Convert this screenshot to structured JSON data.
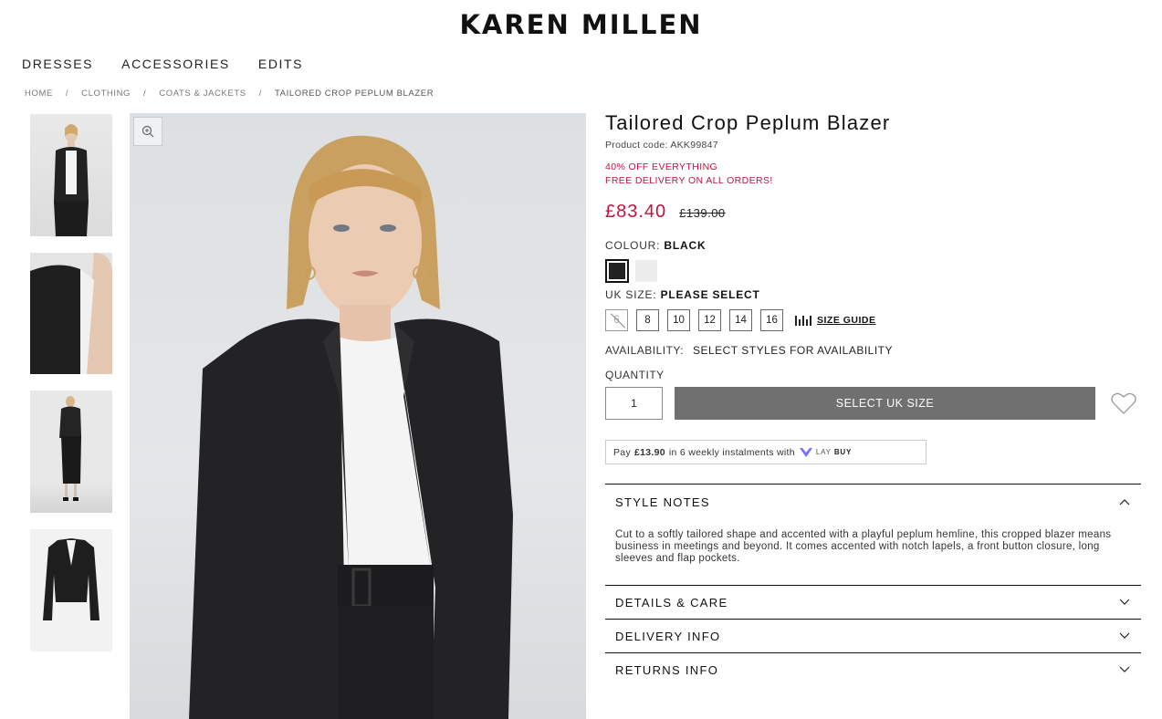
{
  "brand": {
    "logo": "KAREN MILLEN"
  },
  "nav": {
    "items": [
      "DRESSES",
      "ACCESSORIES",
      "EDITS"
    ]
  },
  "breadcrumb": [
    "HOME",
    "CLOTHING",
    "COATS & JACKETS",
    "TAILORED CROP PEPLUM BLAZER"
  ],
  "gallery": {
    "thumbnails": [
      "thumb-front-model",
      "thumb-side-detail",
      "thumb-full-length",
      "thumb-product-flat"
    ]
  },
  "product": {
    "title": "Tailored Crop Peplum Blazer",
    "code": "Product code: AKK99847",
    "promo1": "40% OFF EVERYTHING",
    "promo2": "FREE DELIVERY ON ALL ORDERS!",
    "price_now": "£83.40",
    "price_was": "£139.00",
    "colour_label": "COLOUR:",
    "colour_value": "BLACK",
    "colours": [
      "black",
      "white"
    ],
    "size_label": "UK SIZE:",
    "size_value": "PLEASE SELECT",
    "sizes": [
      "6",
      "8",
      "10",
      "12",
      "14",
      "16"
    ],
    "size_guide": "SIZE GUIDE",
    "availability_label": "AVAILABILITY:",
    "availability_value": "SELECT STYLES FOR AVAILABILITY",
    "quantity_label": "QUANTITY",
    "quantity_value": "1",
    "select_button": "SELECT UK SIZE"
  },
  "laybuy": {
    "prefix": "Pay",
    "amount": "£13.90",
    "suffix": "in 6 weekly instalments with",
    "brand_lay": "LAY",
    "brand_buy": "BUY"
  },
  "accordion": {
    "style_notes": {
      "title": "STYLE NOTES",
      "body": "Cut to a softly tailored shape and accented with a playful peplum hemline, this cropped blazer means business in meetings and beyond. It comes accented with notch lapels, a front button closure, long sleeves and flap pockets."
    },
    "details": {
      "title": "DETAILS & CARE"
    },
    "delivery": {
      "title": "DELIVERY INFO"
    },
    "returns": {
      "title": "RETURNS INFO"
    }
  },
  "colors": {
    "sale_red": "#c0143c",
    "button_grey": "#707070",
    "laybuy_purple": "#786dff"
  }
}
